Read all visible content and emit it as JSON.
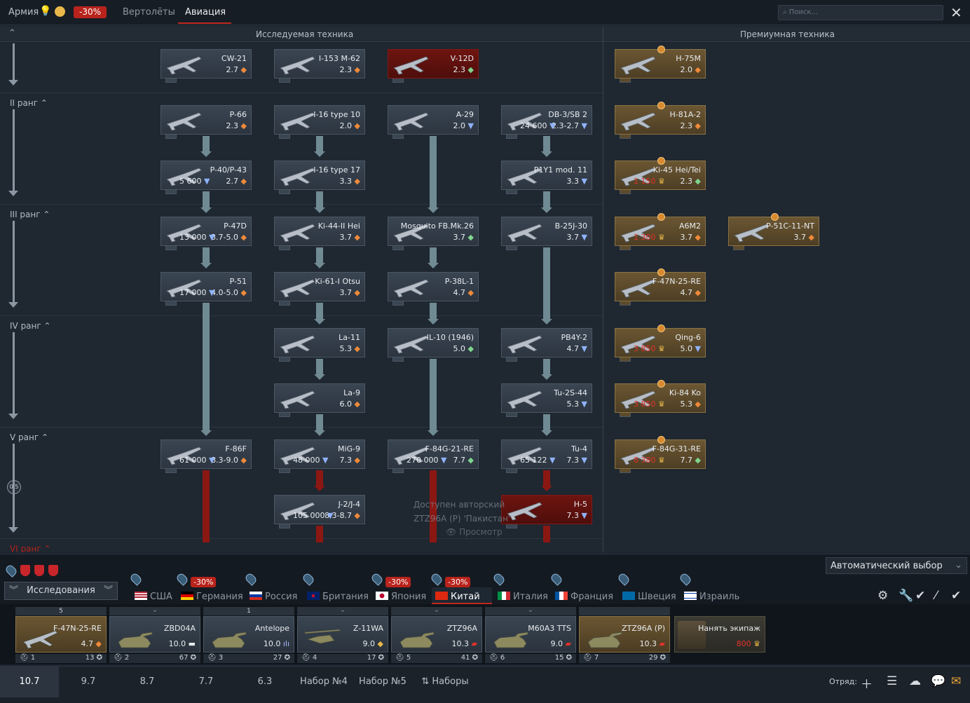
{
  "topbar": {
    "army_label": "Армия",
    "army_discount": "-30%",
    "tab_helicopters": "Вертолёты",
    "tab_aviation": "Авиация",
    "search_placeholder": "Поиск...",
    "close_label": "✕"
  },
  "sections": {
    "researched": "Исследуемая техника",
    "premium": "Премиумная техника"
  },
  "ranks": [
    "II ранг",
    "III ранг",
    "IV ранг",
    "V ранг",
    "VI ранг"
  ],
  "rank_progress": "0/5",
  "researched_cards": [
    {
      "id": "cw21",
      "name": "CW-21",
      "br": "2.7",
      "cost": "",
      "currency": "diamond",
      "status": "normal"
    },
    {
      "id": "i153",
      "name": "I-153 M-62",
      "br": "2.3",
      "cost": "",
      "currency": "diamond",
      "status": "normal"
    },
    {
      "id": "v12d",
      "name": "V-12D",
      "br": "2.3",
      "cost": "",
      "currency": "green",
      "status": "locked"
    },
    {
      "id": "p66",
      "name": "P-66",
      "br": "2.3",
      "cost": "",
      "currency": "diamond",
      "status": "normal"
    },
    {
      "id": "i16t10",
      "name": "I-16 type 10",
      "br": "2.0",
      "cost": "",
      "currency": "diamond",
      "status": "normal"
    },
    {
      "id": "a29",
      "name": "A-29",
      "br": "2.0",
      "cost": "",
      "currency": "blue",
      "status": "normal"
    },
    {
      "id": "db3",
      "name": "DB-3/SB 2",
      "br": "2.3-2.7",
      "cost": "24 600",
      "currency": "blue",
      "status": "normal"
    },
    {
      "id": "p40",
      "name": "P-40/P-43",
      "br": "2.7",
      "cost": "5 600",
      "currency": "diamond",
      "status": "normal"
    },
    {
      "id": "i16t17",
      "name": "I-16 type 17",
      "br": "3.3",
      "cost": "",
      "currency": "diamond",
      "status": "normal"
    },
    {
      "id": "p1y1",
      "name": "P1Y1 mod. 11",
      "br": "3.3",
      "cost": "",
      "currency": "blue",
      "status": "normal"
    },
    {
      "id": "p47d",
      "name": "P-47D",
      "br": "3.7-5.0",
      "cost": "13 000",
      "currency": "diamond",
      "status": "normal"
    },
    {
      "id": "ki44",
      "name": "Ki-44-II Hei",
      "br": "3.7",
      "cost": "",
      "currency": "diamond",
      "status": "normal"
    },
    {
      "id": "mosq",
      "name": "Mosquito FB.Mk.26",
      "br": "3.7",
      "cost": "",
      "currency": "green",
      "status": "normal"
    },
    {
      "id": "b25",
      "name": "B-25J-30",
      "br": "3.7",
      "cost": "",
      "currency": "blue",
      "status": "normal"
    },
    {
      "id": "p51",
      "name": "P-51",
      "br": "4.0-5.0",
      "cost": "17 000",
      "currency": "diamond",
      "status": "normal"
    },
    {
      "id": "ki61",
      "name": "Ki-61-I Otsu",
      "br": "3.7",
      "cost": "",
      "currency": "diamond",
      "status": "normal"
    },
    {
      "id": "p38",
      "name": "P-38L-1",
      "br": "4.7",
      "cost": "",
      "currency": "diamond",
      "status": "normal"
    },
    {
      "id": "la11",
      "name": "La-11",
      "br": "5.3",
      "cost": "",
      "currency": "diamond",
      "status": "normal"
    },
    {
      "id": "il10",
      "name": "IL-10 (1946)",
      "br": "5.0",
      "cost": "",
      "currency": "green",
      "status": "normal"
    },
    {
      "id": "pb4y",
      "name": "PB4Y-2",
      "br": "4.7",
      "cost": "",
      "currency": "blue",
      "status": "normal"
    },
    {
      "id": "la9",
      "name": "La-9",
      "br": "6.0",
      "cost": "",
      "currency": "diamond",
      "status": "normal"
    },
    {
      "id": "tu2",
      "name": "Tu-2S-44",
      "br": "5.3",
      "cost": "",
      "currency": "blue",
      "status": "normal"
    },
    {
      "id": "f86",
      "name": "F-86F",
      "br": "8.3-9.0",
      "cost": "61 000",
      "currency": "diamond",
      "status": "normal"
    },
    {
      "id": "mig9",
      "name": "MiG-9",
      "br": "7.3",
      "cost": "48 000",
      "currency": "diamond",
      "status": "normal"
    },
    {
      "id": "f84g21",
      "name": "F-84G-21-RE",
      "br": "7.7",
      "cost": "270 000",
      "currency": "green",
      "status": "normal"
    },
    {
      "id": "tu4",
      "name": "Tu-4",
      "br": "7.3",
      "cost": "65 122",
      "currency": "blue",
      "status": "normal"
    },
    {
      "id": "j2",
      "name": "J-2/J-4",
      "br": "8.3-8.7",
      "cost": "105 000",
      "currency": "diamond",
      "status": "normal"
    },
    {
      "id": "h5",
      "name": "H-5",
      "br": "7.3",
      "cost": "",
      "currency": "blue",
      "status": "locked"
    }
  ],
  "premium_cards": [
    {
      "id": "h75m",
      "name": "H-75M",
      "br": "2.0",
      "cost": "",
      "currency": "diamond"
    },
    {
      "id": "h81",
      "name": "H-81A-2",
      "br": "2.3",
      "cost": "",
      "currency": "diamond"
    },
    {
      "id": "ki45",
      "name": "Ki-45 Hei/Tei",
      "br": "2.3",
      "cost": "1 150",
      "currency": "green"
    },
    {
      "id": "a6m2",
      "name": "A6M2",
      "br": "3.7",
      "cost": "1 300",
      "currency": "diamond"
    },
    {
      "id": "p51c",
      "name": "P-51C-11-NT",
      "br": "3.7",
      "cost": "",
      "currency": "diamond"
    },
    {
      "id": "f47n",
      "name": "F-47N-25-RE",
      "br": "4.7",
      "cost": "",
      "currency": "diamond"
    },
    {
      "id": "qing6",
      "name": "Qing-6",
      "br": "5.0",
      "cost": "3 850",
      "currency": "blue"
    },
    {
      "id": "ki84",
      "name": "Ki-84 Ko",
      "br": "5.3",
      "cost": "3 850",
      "currency": "diamond"
    },
    {
      "id": "f84g31",
      "name": "F-84G-31-RE",
      "br": "7.7",
      "cost": "8 380",
      "currency": "green"
    }
  ],
  "hint": {
    "line1": "Доступен авторский",
    "line2": "ZTZ96A (P) 'Пакистан'",
    "button": "Просмотр"
  },
  "auto_select": "Автоматический выбор",
  "research_tab": "Исследования",
  "nations": [
    {
      "name": "США",
      "discount": ""
    },
    {
      "name": "Германия",
      "discount": "-30%"
    },
    {
      "name": "Россия",
      "discount": ""
    },
    {
      "name": "Британия",
      "discount": ""
    },
    {
      "name": "Япония",
      "discount": "-30%"
    },
    {
      "name": "Китай",
      "discount": "-30%"
    },
    {
      "name": "Италия",
      "discount": ""
    },
    {
      "name": "Франция",
      "discount": ""
    },
    {
      "name": "Швеция",
      "discount": ""
    },
    {
      "name": "Израиль",
      "discount": ""
    }
  ],
  "active_nation": "Китай",
  "crew_slots": [
    {
      "name": "F-47N-25-RE",
      "br": "4.7",
      "br_icon": "diamond",
      "crew": "1",
      "skill": "13",
      "top": "5",
      "type": "plane",
      "premium": true
    },
    {
      "name": "ZBD04A",
      "br": "10.0",
      "br_icon": "dash",
      "crew": "2",
      "skill": "67",
      "top": "–",
      "type": "tank",
      "premium": false
    },
    {
      "name": "Antelope",
      "br": "10.0",
      "br_icon": "aa",
      "crew": "3",
      "skill": "27",
      "top": "1",
      "type": "tank",
      "premium": false
    },
    {
      "name": "Z-11WA",
      "br": "9.0",
      "br_icon": "heli",
      "crew": "4",
      "skill": "17",
      "top": "–",
      "type": "heli",
      "premium": false
    },
    {
      "name": "ZTZ96A",
      "br": "10.3",
      "br_icon": "tank",
      "crew": "5",
      "skill": "41",
      "top": "–",
      "type": "tank",
      "premium": false
    },
    {
      "name": "M60A3 TTS",
      "br": "9.0",
      "br_icon": "tank",
      "crew": "6",
      "skill": "15",
      "top": "–",
      "type": "tank",
      "premium": false
    },
    {
      "name": "ZTZ96A (P)",
      "br": "10.3",
      "br_icon": "tank",
      "crew": "7",
      "skill": "29",
      "top": "",
      "type": "tank",
      "premium": true
    }
  ],
  "hire_crew": {
    "label": "Нанять экипаж",
    "cost": "800"
  },
  "presets": [
    "10.7",
    "9.7",
    "8.7",
    "7.7",
    "6.3",
    "Набор №4",
    "Набор №5"
  ],
  "presets_menu": "Наборы",
  "squad_label": "Отряд:",
  "colors": {
    "accent": "#c0281f",
    "premium": "#6b5632",
    "locked": "#6e1410"
  }
}
